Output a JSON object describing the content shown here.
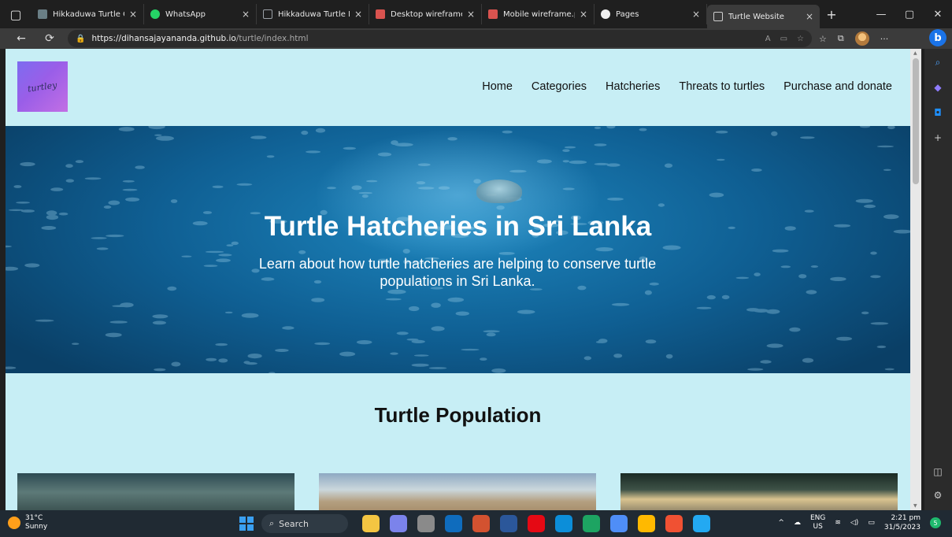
{
  "browser": {
    "tabs": [
      {
        "label": "Hikkaduwa Turtle Con",
        "favicon_color": "#6a7f86",
        "active": false
      },
      {
        "label": "WhatsApp",
        "favicon_color": "#25d366",
        "active": false
      },
      {
        "label": "Hikkaduwa Turtle Hat",
        "favicon_color": "#9aa0a6",
        "active": false
      },
      {
        "label": "Desktop wireframe.pd",
        "favicon_color": "#d9534f",
        "active": false
      },
      {
        "label": "Mobile wireframe.pdf",
        "favicon_color": "#d9534f",
        "active": false
      },
      {
        "label": "Pages",
        "favicon_color": "#f0f0f0",
        "active": false
      },
      {
        "label": "Turtle Website",
        "favicon_color": "#cfcfcf",
        "active": true
      }
    ],
    "tab_close": "×",
    "new_tab": "+",
    "window_controls": {
      "minimize": "—",
      "restore": "▢",
      "close": "✕"
    },
    "url_host": "https://dihansajayananda.github.io",
    "url_path": "/turtle/index.html",
    "back": "←",
    "refresh": "⟳",
    "lock": "🔒",
    "read_aloud": "A",
    "more": "···",
    "bing": "b"
  },
  "site": {
    "logo_text": "turtley",
    "nav": [
      "Home",
      "Categories",
      "Hatcheries",
      "Threats to turtles",
      "Purchase and donate"
    ],
    "hero_title": "Turtle Hatcheries in Sri Lanka",
    "hero_subtitle": "Learn about how turtle hatcheries are helping to conserve turtle populations in Sri Lanka.",
    "section_title": "Turtle Population"
  },
  "taskbar": {
    "temperature": "31°C",
    "condition": "Sunny",
    "search_label": "Search",
    "language": "ENG",
    "region": "US",
    "time": "2:21 pm",
    "date": "31/5/2023",
    "notification_count": "5",
    "app_colors": [
      "#f4c542",
      "#7b83eb",
      "#8a8a8a",
      "#0f6cbd",
      "#d35230",
      "#2b579a",
      "#e50914",
      "#0c8ed9",
      "#1da462",
      "#4f8ef7",
      "#ffb900",
      "#f05133",
      "#23a9f2"
    ]
  },
  "colors": {
    "page_bg": "#c7eef5",
    "hero_text": "#ffffff",
    "logo_gradient_start": "#7d6cf0",
    "logo_gradient_end": "#c26fe4"
  }
}
